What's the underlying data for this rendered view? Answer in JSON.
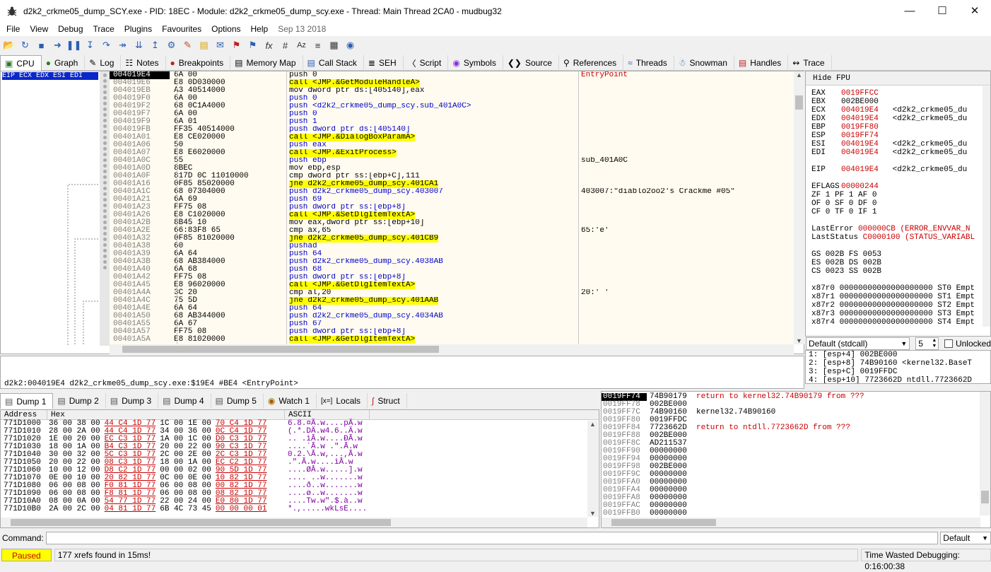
{
  "window": {
    "title": "d2k2_crkme05_dump_SCY.exe - PID: 18EC - Module: d2k2_crkme05_dump_scy.exe - Thread: Main Thread 2CA0 - mudbug32",
    "buttons": [
      "minimize-icon",
      "maximize-icon",
      "close-icon"
    ]
  },
  "menu": {
    "items": [
      "File",
      "View",
      "Debug",
      "Trace",
      "Plugins",
      "Favourites",
      "Options",
      "Help"
    ],
    "date": "Sep 13 2018"
  },
  "toolbar": {
    "icons": [
      "open-icon",
      "restart-icon",
      "stop-icon",
      "run-icon",
      "pause-icon",
      "step-into-icon",
      "step-over-icon",
      "trace-into-icon",
      "trace-over-icon",
      "execute-till-return-icon",
      "execute-till-user-code-icon",
      "scylla-icon",
      "patch-icon",
      "comment-icon",
      "label-icon",
      "bookmark-icon",
      "function-icon",
      "hash-icon",
      "font-icon",
      "strings-icon",
      "calculator-icon",
      "help-icon"
    ]
  },
  "tabs": [
    {
      "label": "CPU",
      "icon": "cpu-icon"
    },
    {
      "label": "Graph",
      "icon": "graph-icon"
    },
    {
      "label": "Log",
      "icon": "log-icon"
    },
    {
      "label": "Notes",
      "icon": "notes-icon"
    },
    {
      "label": "Breakpoints",
      "icon": "breakpoint-icon"
    },
    {
      "label": "Memory Map",
      "icon": "memory-icon"
    },
    {
      "label": "Call Stack",
      "icon": "callstack-icon"
    },
    {
      "label": "SEH",
      "icon": "seh-icon"
    },
    {
      "label": "Script",
      "icon": "script-icon"
    },
    {
      "label": "Symbols",
      "icon": "symbols-icon"
    },
    {
      "label": "Source",
      "icon": "source-icon"
    },
    {
      "label": "References",
      "icon": "references-icon"
    },
    {
      "label": "Threads",
      "icon": "threads-icon"
    },
    {
      "label": "Snowman",
      "icon": "snowman-icon"
    },
    {
      "label": "Handles",
      "icon": "handles-icon"
    },
    {
      "label": "Trace",
      "icon": "trace-icon"
    }
  ],
  "cpu": {
    "eip_label": "EIP ECX EDX ESI EDI",
    "rows": [
      {
        "addr": "004019E4",
        "bytes": "6A 00",
        "ins": "push 0",
        "cmt": "EntryPoint",
        "style": "cur"
      },
      {
        "addr": "004019E6",
        "bytes": "E8 0D030000",
        "ins": "call <JMP.&GetModuleHandleA>",
        "cmt": "",
        "style": "call"
      },
      {
        "addr": "004019EB",
        "bytes": "A3 40514000",
        "ins": "mov dword ptr ds:[405140],eax",
        "cmt": "",
        "style": ""
      },
      {
        "addr": "004019F0",
        "bytes": "6A 00",
        "ins": "push 0",
        "cmt": "",
        "style": "push"
      },
      {
        "addr": "004019F2",
        "bytes": "68 0C1A4000",
        "ins": "push <d2k2_crkme05_dump_scy.sub_401A0C>",
        "cmt": "",
        "style": "push"
      },
      {
        "addr": "004019F7",
        "bytes": "6A 00",
        "ins": "push 0",
        "cmt": "",
        "style": "push"
      },
      {
        "addr": "004019F9",
        "bytes": "6A 01",
        "ins": "push 1",
        "cmt": "",
        "style": "push"
      },
      {
        "addr": "004019FB",
        "bytes": "FF35 40514000",
        "ins": "push dword ptr ds:[405140]",
        "cmt": "",
        "style": "push"
      },
      {
        "addr": "00401A01",
        "bytes": "E8 CE020000",
        "ins": "call <JMP.&DialogBoxParamA>",
        "cmt": "",
        "style": "call"
      },
      {
        "addr": "00401A06",
        "bytes": "50",
        "ins": "push eax",
        "cmt": "",
        "style": "push"
      },
      {
        "addr": "00401A07",
        "bytes": "E8 E6020000",
        "ins": "call <JMP.&ExitProcess>",
        "cmt": "",
        "style": "call"
      },
      {
        "addr": "00401A0C",
        "bytes": "55",
        "ins": "push ebp",
        "cmt": "sub_401A0C",
        "style": "push"
      },
      {
        "addr": "00401A0D",
        "bytes": "8BEC",
        "ins": "mov ebp,esp",
        "cmt": "",
        "style": ""
      },
      {
        "addr": "00401A0F",
        "bytes": "817D 0C 11010000",
        "ins": "cmp dword ptr ss:[ebp+C],111",
        "cmt": "",
        "style": ""
      },
      {
        "addr": "00401A16",
        "bytes": "0F85 85020000",
        "ins": "jne d2k2_crkme05_dump_scy.401CA1",
        "cmt": "",
        "style": "jne"
      },
      {
        "addr": "00401A1C",
        "bytes": "68 07304000",
        "ins": "push d2k2_crkme05_dump_scy.403007",
        "cmt": "403007:\"diablo2oo2's Crackme #05\"",
        "style": "push"
      },
      {
        "addr": "00401A21",
        "bytes": "6A 69",
        "ins": "push 69",
        "cmt": "",
        "style": "push"
      },
      {
        "addr": "00401A23",
        "bytes": "FF75 08",
        "ins": "push dword ptr ss:[ebp+8]",
        "cmt": "",
        "style": "push"
      },
      {
        "addr": "00401A26",
        "bytes": "E8 C1020000",
        "ins": "call <JMP.&SetDlgItemTextA>",
        "cmt": "",
        "style": "call"
      },
      {
        "addr": "00401A2B",
        "bytes": "8B45 10",
        "ins": "mov eax,dword ptr ss:[ebp+10]",
        "cmt": "",
        "style": ""
      },
      {
        "addr": "00401A2E",
        "bytes": "66:83F8 65",
        "ins": "cmp ax,65",
        "cmt": "65:'e'",
        "style": ""
      },
      {
        "addr": "00401A32",
        "bytes": "0F85 81020000",
        "ins": "jne d2k2_crkme05_dump_scy.401CB9",
        "cmt": "",
        "style": "jne"
      },
      {
        "addr": "00401A38",
        "bytes": "60",
        "ins": "pushad",
        "cmt": "",
        "style": "push"
      },
      {
        "addr": "00401A39",
        "bytes": "6A 64",
        "ins": "push 64",
        "cmt": "",
        "style": "push"
      },
      {
        "addr": "00401A3B",
        "bytes": "68 AB384000",
        "ins": "push d2k2_crkme05_dump_scy.4038AB",
        "cmt": "",
        "style": "push"
      },
      {
        "addr": "00401A40",
        "bytes": "6A 68",
        "ins": "push 68",
        "cmt": "",
        "style": "push"
      },
      {
        "addr": "00401A42",
        "bytes": "FF75 08",
        "ins": "push dword ptr ss:[ebp+8]",
        "cmt": "",
        "style": "push"
      },
      {
        "addr": "00401A45",
        "bytes": "E8 96020000",
        "ins": "call <JMP.&GetDlgItemTextA>",
        "cmt": "",
        "style": "call"
      },
      {
        "addr": "00401A4A",
        "bytes": "3C 20",
        "ins": "cmp al,20",
        "cmt": "20:' '",
        "style": ""
      },
      {
        "addr": "00401A4C",
        "bytes": "75 5D",
        "ins": "jne d2k2_crkme05_dump_scy.401AAB",
        "cmt": "",
        "style": "jne"
      },
      {
        "addr": "00401A4E",
        "bytes": "6A 64",
        "ins": "push 64",
        "cmt": "",
        "style": "push"
      },
      {
        "addr": "00401A50",
        "bytes": "68 AB344000",
        "ins": "push d2k2_crkme05_dump_scy.4034AB",
        "cmt": "",
        "style": "push"
      },
      {
        "addr": "00401A55",
        "bytes": "6A 67",
        "ins": "push 67",
        "cmt": "",
        "style": "push"
      },
      {
        "addr": "00401A57",
        "bytes": "FF75 08",
        "ins": "push dword ptr ss:[ebp+8]",
        "cmt": "",
        "style": "push"
      },
      {
        "addr": "00401A5A",
        "bytes": "E8 81020000",
        "ins": "call <JMP.&GetDlgItemTextA>",
        "cmt": "",
        "style": "call"
      }
    ]
  },
  "registers": {
    "hide_fpu": "Hide FPU",
    "gp": [
      {
        "name": "EAX",
        "val": "0019FFCC",
        "cmt": ""
      },
      {
        "name": "EBX",
        "val": "002BE000",
        "cmt": "",
        "black": true
      },
      {
        "name": "ECX",
        "val": "004019E4",
        "cmt": "<d2k2_crkme05_du"
      },
      {
        "name": "EDX",
        "val": "004019E4",
        "cmt": "<d2k2_crkme05_du"
      },
      {
        "name": "EBP",
        "val": "0019FF80",
        "cmt": ""
      },
      {
        "name": "ESP",
        "val": "0019FF74",
        "cmt": ""
      },
      {
        "name": "ESI",
        "val": "004019E4",
        "cmt": "<d2k2_crkme05_du"
      },
      {
        "name": "EDI",
        "val": "004019E4",
        "cmt": "<d2k2_crkme05_du"
      }
    ],
    "eip": {
      "name": "EIP",
      "val": "004019E4",
      "cmt": "<d2k2_crkme05_du"
    },
    "eflags": {
      "name": "EFLAGS",
      "val": "00000244"
    },
    "flags": [
      "ZF 1  PF 1  AF 0",
      "OF 0  SF 0  DF 0",
      "CF 0  TF 0  IF 1"
    ],
    "lasterror": {
      "name": "LastError",
      "val": "000000CB (ERROR_ENVVAR_N"
    },
    "laststatus": {
      "name": "LastStatus",
      "val": "C0000100 (STATUS_VARIABL"
    },
    "segs": [
      "GS 002B  FS 0053",
      "ES 002B  DS 002B",
      "CS 0023  SS 002B"
    ],
    "fpu": [
      "x87r0 00000000000000000000 ST0 Empt",
      "x87r1 00000000000000000000 ST1 Empt",
      "x87r2 00000000000000000000 ST2 Empt",
      "x87r3 00000000000000000000 ST3 Empt",
      "x87r4 00000000000000000000 ST4 Empt"
    ]
  },
  "callconv": {
    "selected": "Default (stdcall)",
    "argcount": "5",
    "unlocked": "Unlocked"
  },
  "stackargs": [
    "1: [esp+4] 002BE000",
    "2: [esp+8] 74B90160 <kernel32.BaseT",
    "3: [esp+C] 0019FFDC",
    "4: [esp+10] 7723662D ntdll.7723662D"
  ],
  "info": "d2k2:004019E4 d2k2_crkme05_dump_scy.exe:$19E4 #BE4 <EntryPoint>",
  "dump_tabs": [
    {
      "label": "Dump 1",
      "icon": "dump-icon"
    },
    {
      "label": "Dump 2",
      "icon": "dump-icon"
    },
    {
      "label": "Dump 3",
      "icon": "dump-icon"
    },
    {
      "label": "Dump 4",
      "icon": "dump-icon"
    },
    {
      "label": "Dump 5",
      "icon": "dump-icon"
    },
    {
      "label": "Watch 1",
      "icon": "watch-icon"
    },
    {
      "label": "Locals",
      "icon": "locals-icon"
    },
    {
      "label": "Struct",
      "icon": "struct-icon"
    }
  ],
  "dump": {
    "headers": [
      "Address",
      "Hex",
      "ASCII"
    ],
    "rows": [
      {
        "addr": "771D1000",
        "hex": [
          "36 00 38 00",
          "44 C4 1D 77",
          "1C 00 1E 00",
          "70 C4 1D 77"
        ],
        "ascii": "6.8.¤Ä.w....pÄ.w"
      },
      {
        "addr": "771D1010",
        "hex": [
          "28 00 2A 00",
          "44 C4 1D 77",
          "34 00 36 00",
          "0C C4 1D 77"
        ],
        "ascii": "(.*.DÄ.w4.6..Ä.w"
      },
      {
        "addr": "771D1020",
        "hex": [
          "1E 00 20 00",
          "EC C3 1D 77",
          "1A 00 1C 00",
          "D0 C3 1D 77"
        ],
        "ascii": ".. .ìÃ.w....ÐÃ.w"
      },
      {
        "addr": "771D1030",
        "hex": [
          "18 00 1A 00",
          "B4 C3 1D 77",
          "20 00 22 00",
          "90 C3 1D 77"
        ],
        "ascii": "....´Ã.w .\".Ã.w"
      },
      {
        "addr": "771D1040",
        "hex": [
          "30 00 32 00",
          "5C C3 1D 77",
          "2C 00 2E 00",
          "2C C3 1D 77"
        ],
        "ascii": "0.2.\\Ã.w,...,Ã.w"
      },
      {
        "addr": "771D1050",
        "hex": [
          "20 00 22 00",
          "08 C3 1D 77",
          "18 00 1A 00",
          "EC C2 1D 77"
        ],
        "ascii": " .\".Ã.w....ìÂ.w"
      },
      {
        "addr": "771D1060",
        "hex": [
          "10 00 12 00",
          "D8 C2 1D 77",
          "00 00 02 00",
          "90 5D 1D 77"
        ],
        "ascii": "....ØÂ.w.....].w"
      },
      {
        "addr": "771D1070",
        "hex": [
          "0E 00 10 00",
          "20 82 1D 77",
          "0C 00 0E 00",
          "10 82 1D 77"
        ],
        "ascii": ".... ..w.......w"
      },
      {
        "addr": "771D1080",
        "hex": [
          "06 00 08 00",
          "F0 81 1D 77",
          "06 00 08 00",
          "00 82 1D 77"
        ],
        "ascii": "....ð..w.......w"
      },
      {
        "addr": "771D1090",
        "hex": [
          "06 00 08 00",
          "F8 81 1D 77",
          "06 00 08 00",
          "08 82 1D 77"
        ],
        "ascii": "....ø..w.......w"
      },
      {
        "addr": "771D10A0",
        "hex": [
          "08 00 0A 00",
          "54 77 1D 77",
          "22 00 24 00",
          "E0 80 1D 77"
        ],
        "ascii": "....Tw.w\".$.à..w"
      },
      {
        "addr": "771D10B0",
        "hex": [
          "2A 00 2C 00",
          "04 81 1D 77",
          "6B 4C 73 45",
          "00 00 00 01"
        ],
        "ascii": "*.,.....wkLsE...."
      }
    ]
  },
  "stack": {
    "rows": [
      {
        "addr": "0019FF74",
        "val": "74B90179",
        "cmt": "return to kernel32.74B90179 from ???",
        "cur": true,
        "red": true
      },
      {
        "addr": "0019FF78",
        "val": "002BE000",
        "cmt": ""
      },
      {
        "addr": "0019FF7C",
        "val": "74B90160",
        "cmt": "kernel32.74B90160"
      },
      {
        "addr": "0019FF80",
        "val": "0019FFDC",
        "cmt": ""
      },
      {
        "addr": "0019FF84",
        "val": "7723662D",
        "cmt": "return to ntdll.7723662D from ???",
        "red": true
      },
      {
        "addr": "0019FF88",
        "val": "002BE000",
        "cmt": ""
      },
      {
        "addr": "0019FF8C",
        "val": "AD211537",
        "cmt": ""
      },
      {
        "addr": "0019FF90",
        "val": "00000000",
        "cmt": ""
      },
      {
        "addr": "0019FF94",
        "val": "00000000",
        "cmt": ""
      },
      {
        "addr": "0019FF98",
        "val": "002BE000",
        "cmt": ""
      },
      {
        "addr": "0019FF9C",
        "val": "00000000",
        "cmt": ""
      },
      {
        "addr": "0019FFA0",
        "val": "00000000",
        "cmt": ""
      },
      {
        "addr": "0019FFA4",
        "val": "00000000",
        "cmt": ""
      },
      {
        "addr": "0019FFA8",
        "val": "00000000",
        "cmt": ""
      },
      {
        "addr": "0019FFAC",
        "val": "00000000",
        "cmt": ""
      },
      {
        "addr": "0019FFB0",
        "val": "00000000",
        "cmt": ""
      }
    ]
  },
  "command": {
    "label": "Command:",
    "value": "",
    "placeholder": "",
    "mode": "Default"
  },
  "status": {
    "state": "Paused",
    "message": "177 xrefs found in 15ms!",
    "time_wasted": "Time Wasted Debugging: 0:16:00:38"
  },
  "colors": {
    "eip_label_bg": "#0a27c8",
    "call_highlight": "#ffff00",
    "jump_highlight": "#ffff00",
    "register_changed": "#c80000",
    "paused_bg": "#ffff00",
    "paused_fg": "#c80000"
  }
}
